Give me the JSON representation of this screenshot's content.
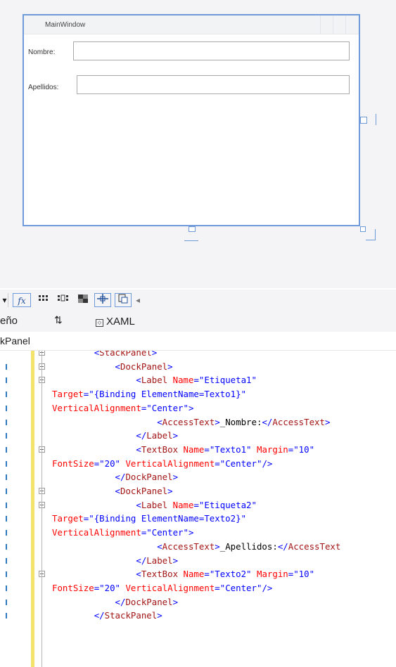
{
  "designer": {
    "window_title": "MainWindow",
    "label_nombre": "Nombre:",
    "label_apellidos": "Apellidos:"
  },
  "toolbar": {
    "fx_label": "fx",
    "buttons": [
      "grid-icon",
      "snap-grid-icon",
      "checker-icon",
      "crosshair-icon",
      "snap-icon",
      "triangle-left-icon"
    ]
  },
  "tabs": {
    "design_label": "eño",
    "swap_label": "⇅",
    "xaml_label": "XAML"
  },
  "breadcrumb": {
    "text": "kPanel"
  },
  "code_lines": [
    {
      "indent": "        ",
      "parts": [
        [
          "br",
          "<"
        ],
        [
          "tag",
          "StackPanel"
        ],
        [
          "br",
          ">"
        ]
      ]
    },
    {
      "indent": "            ",
      "parts": [
        [
          "br",
          "<"
        ],
        [
          "tag",
          "DockPanel"
        ],
        [
          "br",
          ">"
        ]
      ]
    },
    {
      "indent": "                ",
      "parts": [
        [
          "br",
          "<"
        ],
        [
          "tag",
          "Label"
        ],
        [
          "txt",
          " "
        ],
        [
          "attr",
          "Name"
        ],
        [
          "br",
          "=\""
        ],
        [
          "val",
          "Etiqueta1"
        ],
        [
          "br",
          "\""
        ]
      ]
    },
    {
      "indent": "",
      "parts": [
        [
          "attr",
          "Target"
        ],
        [
          "br",
          "=\""
        ],
        [
          "val",
          "{Binding ElementName=Texto1}"
        ],
        [
          "br",
          "\""
        ]
      ]
    },
    {
      "indent": "",
      "parts": [
        [
          "attr",
          "VerticalAlignment"
        ],
        [
          "br",
          "=\""
        ],
        [
          "val",
          "Center"
        ],
        [
          "br",
          "\">"
        ]
      ]
    },
    {
      "indent": "                    ",
      "parts": [
        [
          "br",
          "<"
        ],
        [
          "tag",
          "AccessText"
        ],
        [
          "br",
          ">"
        ],
        [
          "txt",
          "_Nombre:"
        ],
        [
          "br",
          "</"
        ],
        [
          "tag",
          "AccessText"
        ],
        [
          "br",
          ">"
        ]
      ]
    },
    {
      "indent": "                ",
      "parts": [
        [
          "br",
          "</"
        ],
        [
          "tag",
          "Label"
        ],
        [
          "br",
          ">"
        ]
      ]
    },
    {
      "indent": "                ",
      "parts": [
        [
          "br",
          "<"
        ],
        [
          "tag",
          "TextBox"
        ],
        [
          "txt",
          " "
        ],
        [
          "attr",
          "Name"
        ],
        [
          "br",
          "=\""
        ],
        [
          "val",
          "Texto1"
        ],
        [
          "br",
          "\""
        ],
        [
          "txt",
          " "
        ],
        [
          "attr",
          "Margin"
        ],
        [
          "br",
          "=\""
        ],
        [
          "val",
          "10"
        ],
        [
          "br",
          "\""
        ]
      ]
    },
    {
      "indent": "",
      "parts": [
        [
          "attr",
          "FontSize"
        ],
        [
          "br",
          "=\""
        ],
        [
          "val",
          "20"
        ],
        [
          "br",
          "\""
        ],
        [
          "txt",
          " "
        ],
        [
          "attr",
          "VerticalAlignment"
        ],
        [
          "br",
          "=\""
        ],
        [
          "val",
          "Center"
        ],
        [
          "br",
          "\"/>"
        ]
      ]
    },
    {
      "indent": "            ",
      "parts": [
        [
          "br",
          "</"
        ],
        [
          "tag",
          "DockPanel"
        ],
        [
          "br",
          ">"
        ]
      ]
    },
    {
      "indent": "            ",
      "parts": [
        [
          "br",
          "<"
        ],
        [
          "tag",
          "DockPanel"
        ],
        [
          "br",
          ">"
        ]
      ]
    },
    {
      "indent": "                ",
      "parts": [
        [
          "br",
          "<"
        ],
        [
          "tag",
          "Label"
        ],
        [
          "txt",
          " "
        ],
        [
          "attr",
          "Name"
        ],
        [
          "br",
          "=\""
        ],
        [
          "val",
          "Etiqueta2"
        ],
        [
          "br",
          "\""
        ]
      ]
    },
    {
      "indent": "",
      "parts": [
        [
          "attr",
          "Target"
        ],
        [
          "br",
          "=\""
        ],
        [
          "val",
          "{Binding ElementName=Texto2}"
        ],
        [
          "br",
          "\""
        ]
      ]
    },
    {
      "indent": "",
      "parts": [
        [
          "attr",
          "VerticalAlignment"
        ],
        [
          "br",
          "=\""
        ],
        [
          "val",
          "Center"
        ],
        [
          "br",
          "\">"
        ]
      ]
    },
    {
      "indent": "                    ",
      "parts": [
        [
          "br",
          "<"
        ],
        [
          "tag",
          "AccessText"
        ],
        [
          "br",
          ">"
        ],
        [
          "txt",
          "_Apellidos:"
        ],
        [
          "br",
          "</"
        ],
        [
          "tag",
          "AccessText"
        ]
      ]
    },
    {
      "indent": "                ",
      "parts": [
        [
          "br",
          "</"
        ],
        [
          "tag",
          "Label"
        ],
        [
          "br",
          ">"
        ]
      ]
    },
    {
      "indent": "                ",
      "parts": [
        [
          "br",
          "<"
        ],
        [
          "tag",
          "TextBox"
        ],
        [
          "txt",
          " "
        ],
        [
          "attr",
          "Name"
        ],
        [
          "br",
          "=\""
        ],
        [
          "val",
          "Texto2"
        ],
        [
          "br",
          "\""
        ],
        [
          "txt",
          " "
        ],
        [
          "attr",
          "Margin"
        ],
        [
          "br",
          "=\""
        ],
        [
          "val",
          "10"
        ],
        [
          "br",
          "\""
        ]
      ]
    },
    {
      "indent": "",
      "parts": [
        [
          "attr",
          "FontSize"
        ],
        [
          "br",
          "=\""
        ],
        [
          "val",
          "20"
        ],
        [
          "br",
          "\""
        ],
        [
          "txt",
          " "
        ],
        [
          "attr",
          "VerticalAlignment"
        ],
        [
          "br",
          "=\""
        ],
        [
          "val",
          "Center"
        ],
        [
          "br",
          "\"/>"
        ]
      ]
    },
    {
      "indent": "            ",
      "parts": [
        [
          "br",
          "</"
        ],
        [
          "tag",
          "DockPanel"
        ],
        [
          "br",
          ">"
        ]
      ]
    },
    {
      "indent": "        ",
      "parts": [
        [
          "br",
          "</"
        ],
        [
          "tag",
          "StackPanel"
        ],
        [
          "br",
          ">"
        ]
      ]
    }
  ]
}
